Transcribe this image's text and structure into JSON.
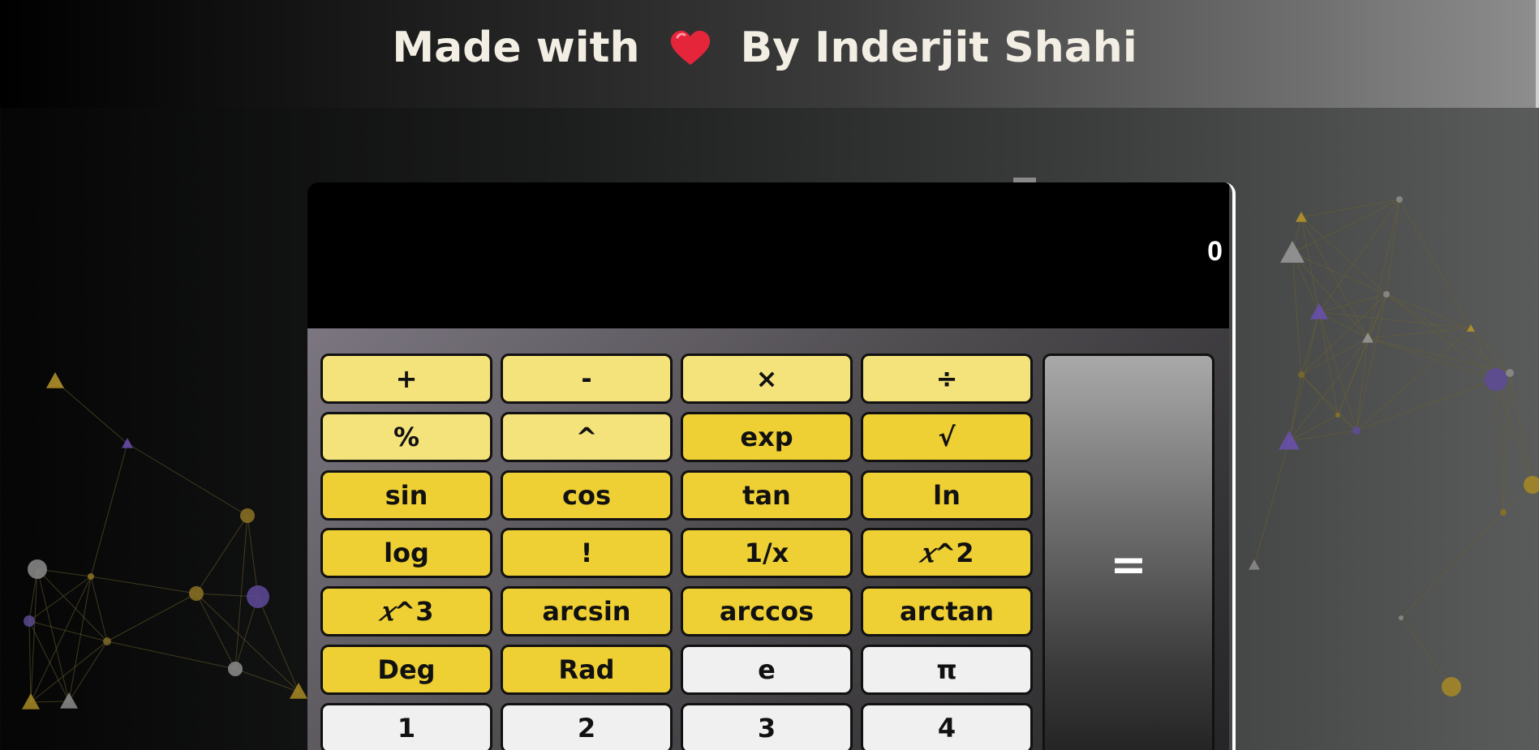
{
  "header": {
    "text_before": "Made with",
    "heart_icon": "heart-icon",
    "text_after": "By Inderjit Shahi"
  },
  "display": {
    "value": "0"
  },
  "colors": {
    "light_key": "#f4e27a",
    "yellow_key": "#efd034",
    "white_key": "#f0f0f0",
    "display_bg": "#000000"
  },
  "keys": {
    "r1": [
      "+",
      "-",
      "×",
      "÷"
    ],
    "r2": [
      "%",
      "^",
      "exp",
      "√"
    ],
    "r3": [
      "sin",
      "cos",
      "tan",
      "ln"
    ],
    "r4": [
      "log",
      "!",
      "1/x",
      "x^2"
    ],
    "r5": [
      "x^3",
      "arcsin",
      "arccos",
      "arctan"
    ],
    "r6": [
      "Deg",
      "Rad",
      "e",
      "π"
    ],
    "r7": [
      "1",
      "2",
      "3",
      "4"
    ]
  },
  "key_parts": {
    "x2_var": "𝑥",
    "x2_rest": "^2",
    "x3_var": "𝑥",
    "x3_rest": "^3"
  },
  "equals_label": "="
}
